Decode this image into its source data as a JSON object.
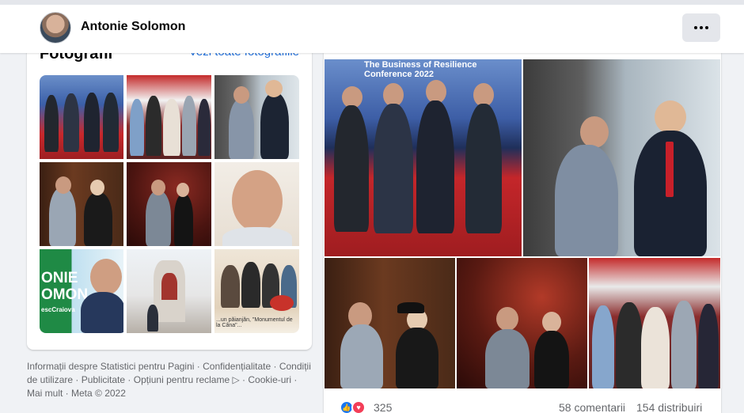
{
  "profile": {
    "name": "Antonie Solomon",
    "more_icon": "ellipsis-icon"
  },
  "photos_card": {
    "title": "Fotografii",
    "see_all": "Vezi toate fotografiile",
    "overlay_text_line1": "ONIE",
    "overlay_text_line2": "OMON",
    "overlay_text_line3": "escCraiova",
    "caption_text": "...un păianjăn, \"Monumentul de la Câna\"..."
  },
  "footer": {
    "links": [
      "Informații despre Statistici pentru Pagini",
      "Confidențialitate",
      "Condiții de utilizare",
      "Publicitate",
      "Opțiuni pentru reclame",
      "Cookie-uri",
      "Mai mult",
      "Meta © 2022"
    ],
    "separator": " · ",
    "adchoices_icon": "adchoices-icon"
  },
  "post": {
    "banner_line1": "The Business of Resilience",
    "banner_line2": "Conference 2022",
    "reaction_icons": [
      "like-icon",
      "love-icon"
    ],
    "reaction_count": "325",
    "comments": "58 comentarii",
    "shares": "154 distribuiri"
  },
  "colors": {
    "link_blue": "#216fdb",
    "like_blue": "#1877f2",
    "love_red": "#f33e58",
    "background": "#f0f2f5"
  }
}
